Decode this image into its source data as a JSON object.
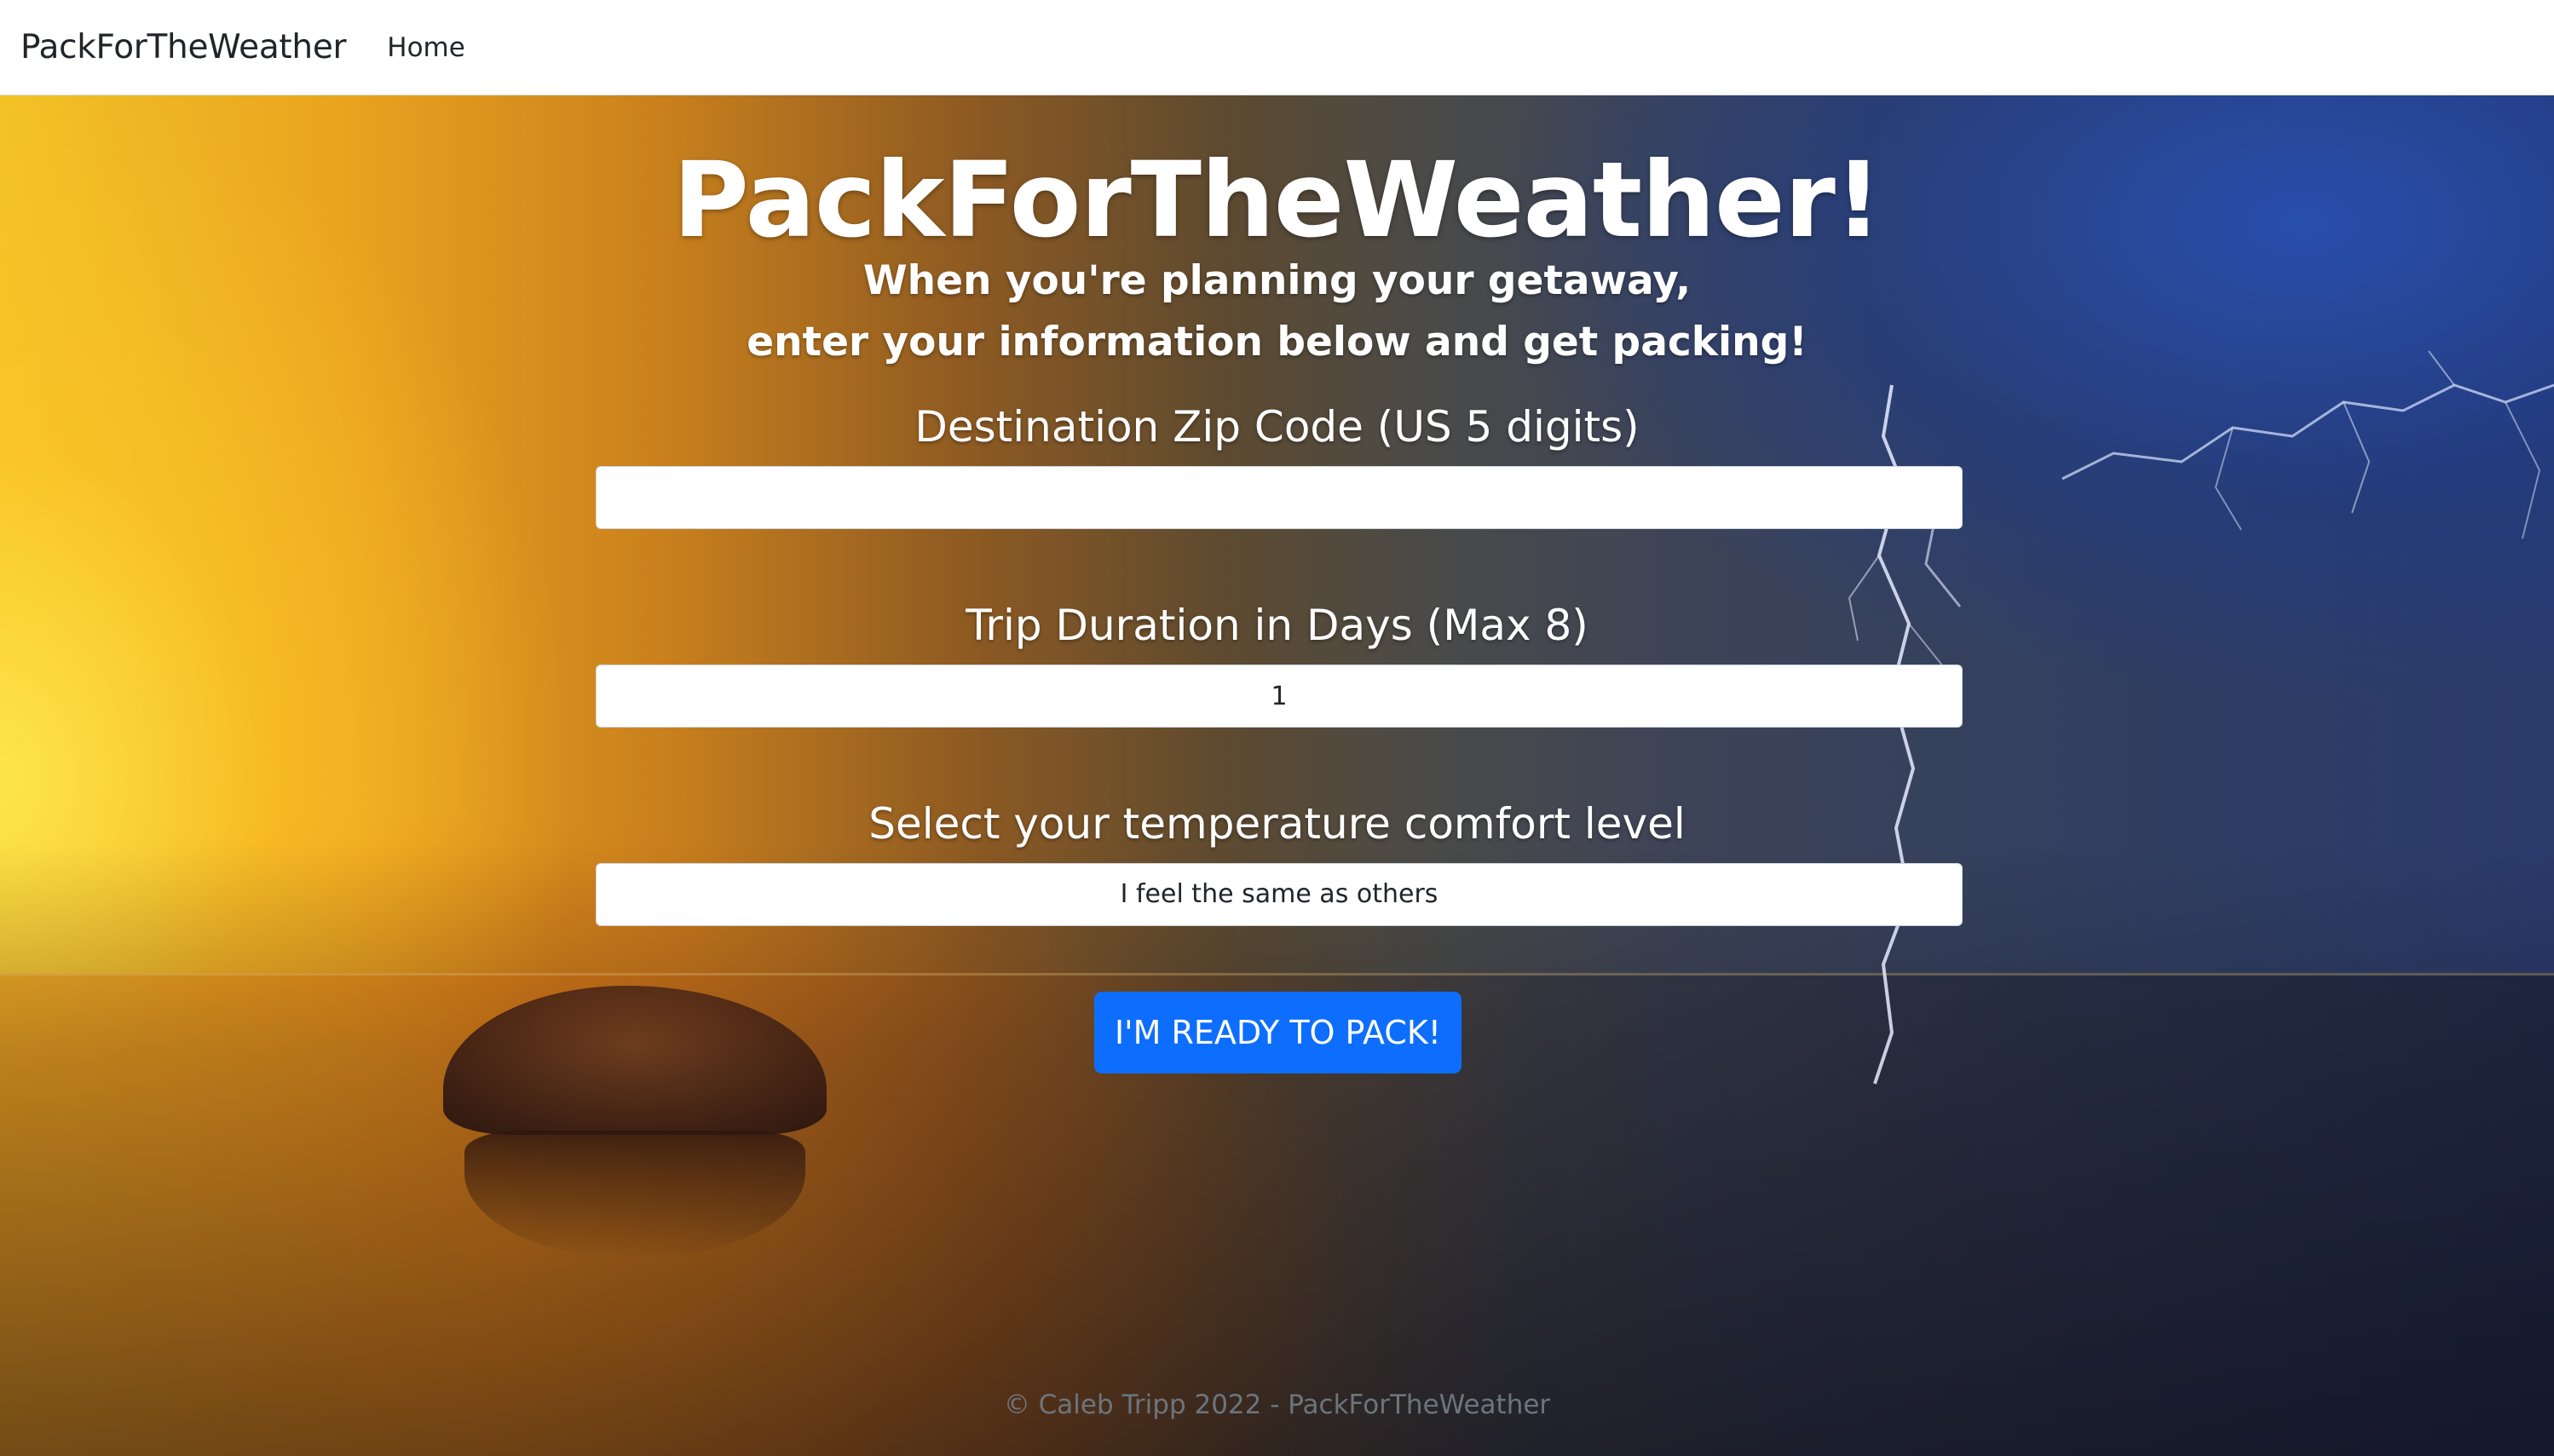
{
  "nav": {
    "brand": "PackForTheWeather",
    "home": "Home"
  },
  "hero": {
    "title": "PackForTheWeather!",
    "subtitle_line1": "When you're planning your getaway,",
    "subtitle_line2": "enter your information below and get packing!"
  },
  "form": {
    "zip": {
      "label": "Destination Zip Code (US 5 digits)",
      "value": ""
    },
    "duration": {
      "label": "Trip Duration in Days (Max 8)",
      "value": "1"
    },
    "comfort": {
      "label": "Select your temperature comfort level",
      "value": "I feel the same as others"
    },
    "submit_label": "I'M READY TO PACK!"
  },
  "footer": {
    "text": "© Caleb Tripp 2022 - PackForTheWeather"
  },
  "colors": {
    "primary_button": "#0d6efd",
    "navbar_bg": "#ffffff",
    "footer_text": "#6c757d"
  }
}
